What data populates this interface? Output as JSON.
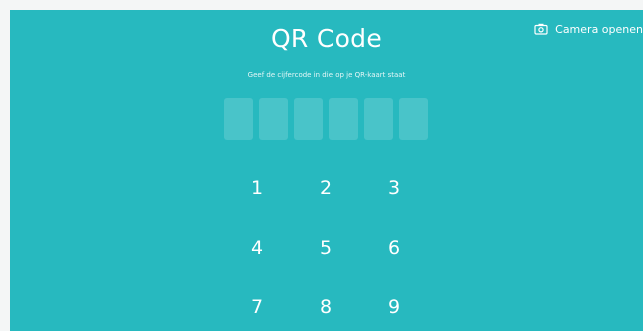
{
  "title": "QR Code",
  "instruction": "Geef de cijfercode in die op je QR-kaart staat",
  "camera_button": {
    "label": "Camera openen",
    "icon": "camera-icon"
  },
  "code_entry": {
    "length": 6,
    "values": [
      "",
      "",
      "",
      "",
      "",
      ""
    ]
  },
  "keypad": {
    "keys": [
      "1",
      "2",
      "3",
      "4",
      "5",
      "6",
      "7",
      "8",
      "9"
    ]
  },
  "colors": {
    "background": "#27b9bf",
    "text": "#ffffff",
    "code_box": "rgba(255,255,255,0.16)"
  }
}
